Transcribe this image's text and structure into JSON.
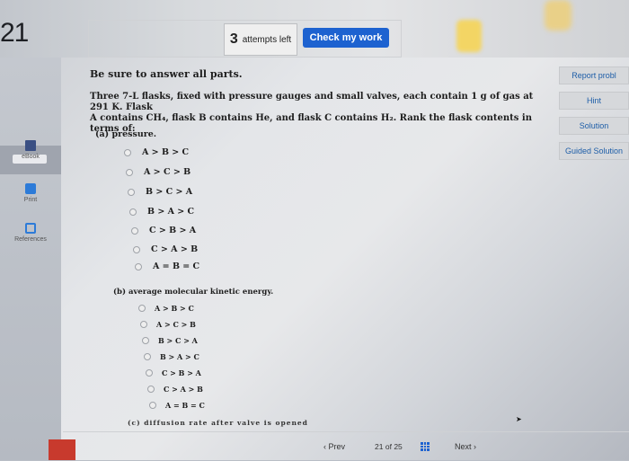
{
  "header": {
    "question_number": "21",
    "attempts_count": "3",
    "attempts_label": "attempts left",
    "check_button": "Check my work"
  },
  "sidebar": {
    "items": [
      {
        "label": "eBook",
        "icon": "book-icon"
      },
      {
        "label": "Print",
        "icon": "printer-icon"
      },
      {
        "label": "References",
        "icon": "references-icon"
      }
    ]
  },
  "right_panel": {
    "buttons": [
      "Report probl",
      "Hint",
      "Solution",
      "Guided Solution"
    ]
  },
  "question": {
    "intro": "Be sure to answer all parts.",
    "text_line1": "Three 7-L flasks, fixed with pressure gauges and small valves, each contain 1 g of gas at 291 K. Flask",
    "text_line2": "A contains CH₄, flask B contains He, and flask C contains H₂. Rank the flask contents in terms of:",
    "part_a": {
      "label": "(a) pressure.",
      "options": [
        "A > B > C",
        "A > C > B",
        "B > C > A",
        "B > A > C",
        "C > B > A",
        "C > A > B",
        "A = B = C"
      ]
    },
    "part_b": {
      "label": "(b) average molecular kinetic energy.",
      "options": [
        "A > B > C",
        "A > C > B",
        "B > C > A",
        "B > A > C",
        "C > B > A",
        "C > A > B",
        "A = B = C"
      ]
    },
    "part_c_cutoff": "(c) diffusion rate after valve is opened"
  },
  "footer": {
    "prev": "Prev",
    "page_current": "21",
    "page_of": "of",
    "page_total": "25",
    "next": "Next"
  },
  "colors": {
    "accent": "#1d62d0",
    "link": "#1e5ea8",
    "logo": "#c83a2d"
  }
}
